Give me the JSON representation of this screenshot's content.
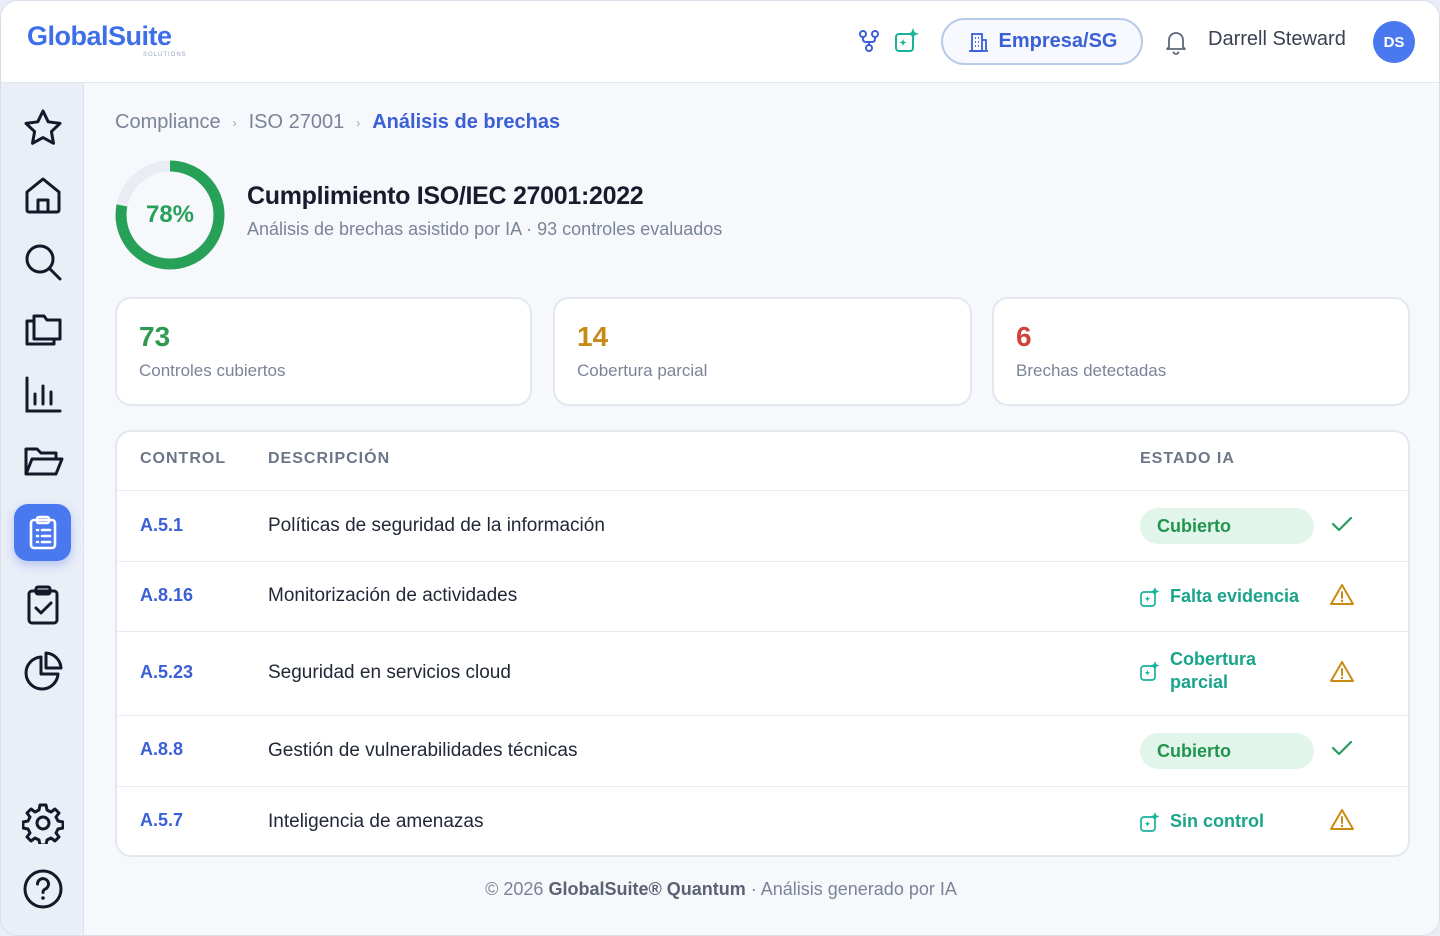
{
  "header": {
    "logo_main": "GlobalSuite",
    "logo_sub": "SOLUTIONS",
    "company_button": "Empresa/SG",
    "user_name": "Darrell Steward",
    "user_initials": "DS"
  },
  "sidebar": {
    "items": [
      {
        "name": "favorites",
        "icon": "star-icon",
        "active": false
      },
      {
        "name": "home",
        "icon": "home-icon",
        "active": false
      },
      {
        "name": "search",
        "icon": "search-icon",
        "active": false
      },
      {
        "name": "documents",
        "icon": "stack-icon",
        "active": false
      },
      {
        "name": "reports",
        "icon": "bar-chart-icon",
        "active": false
      },
      {
        "name": "folders",
        "icon": "folder-open-icon",
        "active": false
      },
      {
        "name": "compliance",
        "icon": "clipboard-list-icon",
        "active": true
      },
      {
        "name": "tasks",
        "icon": "clipboard-check-icon",
        "active": false
      },
      {
        "name": "analytics",
        "icon": "pie-chart-icon",
        "active": false
      },
      {
        "name": "settings",
        "icon": "gear-icon",
        "active": false
      },
      {
        "name": "help",
        "icon": "help-icon",
        "active": false
      }
    ]
  },
  "breadcrumb": {
    "items": [
      "Compliance",
      "ISO 27001"
    ],
    "separator": "›",
    "current": "Análisis de brechas"
  },
  "summary": {
    "percent_label": "78%",
    "percent_value": 0.78,
    "title": "Cumplimiento ISO/IEC 27001:2022",
    "subtitle": "Análisis de brechas asistido por IA · 93 controles evaluados"
  },
  "stats": [
    {
      "value": "73",
      "label": "Controles cubiertos",
      "color": "#2f9a4f"
    },
    {
      "value": "14",
      "label": "Cobertura parcial",
      "color": "#c78a16"
    },
    {
      "value": "6",
      "label": "Brechas detectadas",
      "color": "#d0423c"
    }
  ],
  "table": {
    "headers": {
      "control": "CONTROL",
      "description": "DESCRIPCIÓN",
      "status": "ESTADO IA"
    },
    "rows": [
      {
        "code": "A.5.1",
        "description": "Políticas de seguridad de la información",
        "status": "Cubierto",
        "kind": "covered",
        "status_icon": "check-icon"
      },
      {
        "code": "A.8.16",
        "description": "Monitorización de actividades",
        "status": "Falta evidencia",
        "kind": "ai",
        "status_icon": "warning-icon"
      },
      {
        "code": "A.5.23",
        "description": "Seguridad en servicios cloud",
        "status_line1": "Cobertura",
        "status_line2": "parcial",
        "kind": "ai-two-line",
        "status_icon": "warning-icon"
      },
      {
        "code": "A.8.8",
        "description": "Gestión de vulnerabilidades técnicas",
        "status": "Cubierto",
        "kind": "covered",
        "status_icon": "check-icon"
      },
      {
        "code": "A.5.7",
        "description": "Inteligencia de amenazas",
        "status": "Sin control",
        "kind": "ai",
        "status_icon": "warning-icon"
      }
    ]
  },
  "footer": {
    "prefix": "© 2026 ",
    "brand": "GlobalSuite® Quantum",
    "suffix": " · Análisis generado por IA"
  },
  "colors": {
    "accent": "#4a78ee",
    "ring_green": "#27a058",
    "ring_track": "#e9edf3",
    "ai_teal": "#1aa58a",
    "warning": "#c98b12"
  }
}
